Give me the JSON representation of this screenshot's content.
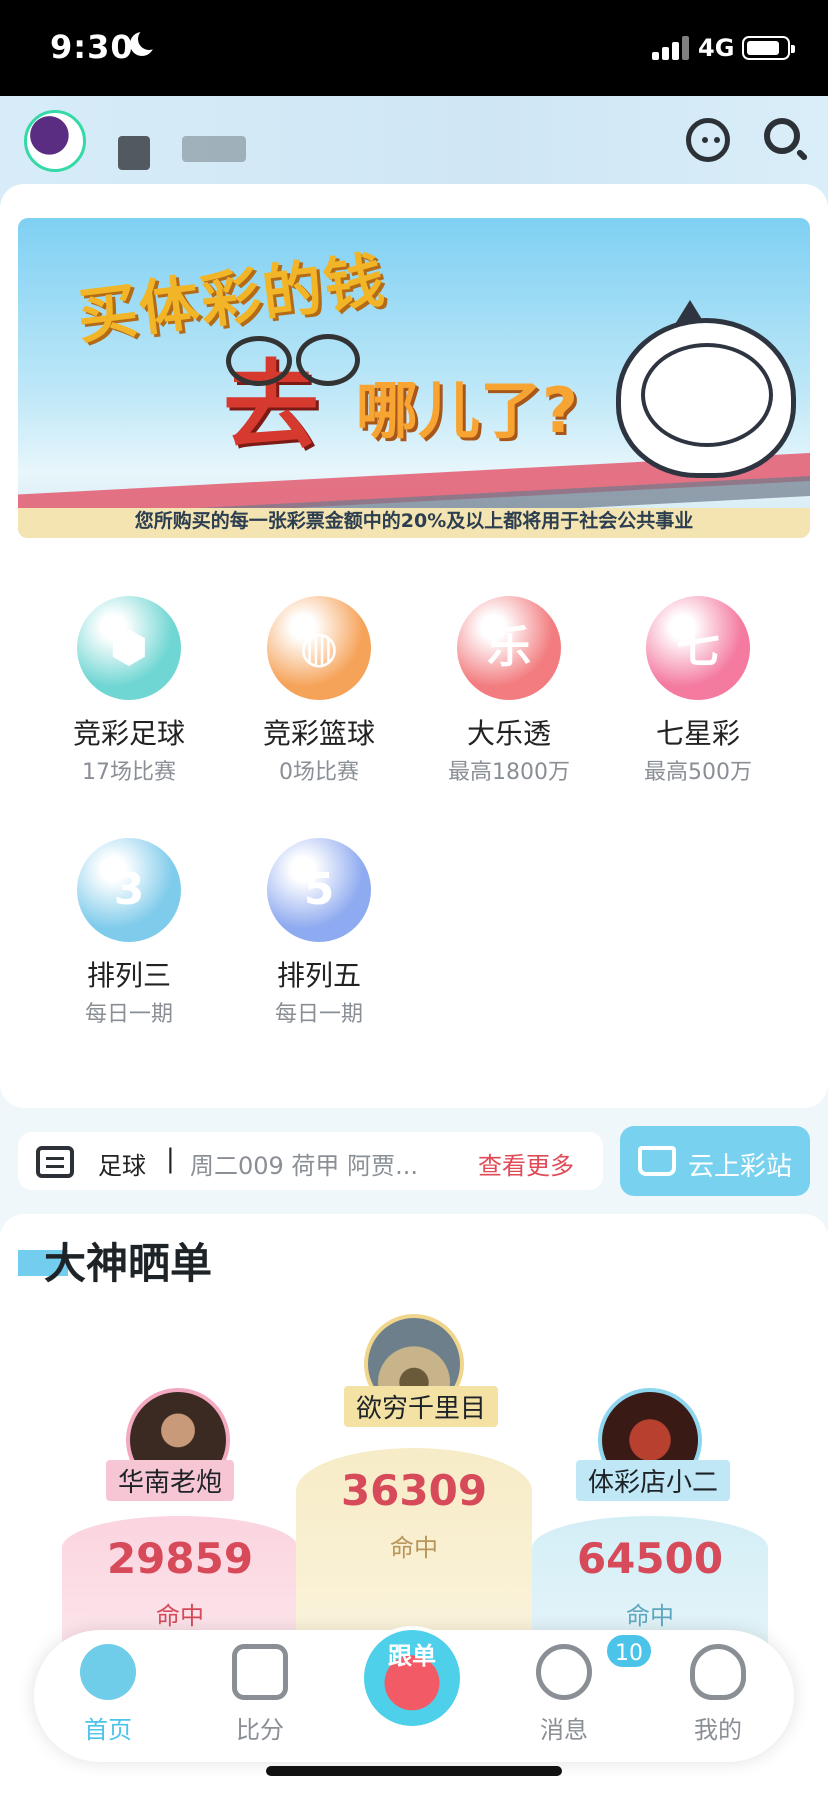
{
  "status_bar": {
    "time": "9:30",
    "network": "4G"
  },
  "banner": {
    "headline_1": "买体彩的钱",
    "headline_2": "去",
    "headline_3": "哪儿了?",
    "caption": "您所购买的每一张彩票金额中的20%及以上都将用于社会公共事业"
  },
  "lotteries": [
    {
      "name": "竞彩足球",
      "sub": "17场比赛",
      "icon": "football-icon",
      "glyph": "⬢",
      "color": "#6fd6d3"
    },
    {
      "name": "竞彩篮球",
      "sub": "0场比赛",
      "icon": "basketball-icon",
      "glyph": "◍",
      "color": "#f6a35a"
    },
    {
      "name": "大乐透",
      "sub": "最高1800万",
      "icon": "star-le-icon",
      "glyph": "乐",
      "color": "#f27c7f"
    },
    {
      "name": "七星彩",
      "sub": "最高500万",
      "icon": "star-qi-icon",
      "glyph": "七",
      "color": "#f47aa0"
    },
    {
      "name": "排列三",
      "sub": "每日一期",
      "icon": "ball-3-icon",
      "glyph": "3",
      "color": "#7fcbeb"
    },
    {
      "name": "排列五",
      "sub": "每日一期",
      "icon": "ball-5-icon",
      "glyph": "5",
      "color": "#8eaaf0"
    }
  ],
  "news": {
    "category": "足球",
    "separator": "|",
    "message": "周二009 荷甲 阿贾...",
    "more": "查看更多"
  },
  "station": {
    "label": "云上彩站"
  },
  "leaderboard": {
    "title": "大神晒单",
    "hit_label": "命中",
    "first": {
      "name": "欲穷千里目",
      "value": "36309"
    },
    "second": {
      "name": "华南老炮",
      "value": "29859"
    },
    "third": {
      "name": "体彩店小二",
      "value": "64500"
    }
  },
  "tabbar": {
    "home": "首页",
    "score": "比分",
    "follow": "跟单",
    "messages": "消息",
    "messages_badge": "10",
    "mine": "我的"
  }
}
